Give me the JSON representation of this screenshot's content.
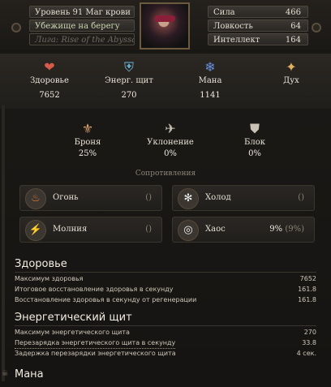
{
  "header": {
    "level_class": "Уровень 91 Маг крови",
    "area": "Убежище на берегу",
    "league": "Лига: Rise of the Abyssal",
    "attributes": [
      {
        "label": "Сила",
        "value": "466"
      },
      {
        "label": "Ловкость",
        "value": "64"
      },
      {
        "label": "Интеллект",
        "value": "164"
      }
    ]
  },
  "main_stats": [
    {
      "label": "Здоровье",
      "value": "7652",
      "icon": "heart-icon",
      "glyph": "❤",
      "color": "#d85a4a"
    },
    {
      "label": "Энерг. щит",
      "value": "270",
      "icon": "energy-shield-icon",
      "glyph": "⛨",
      "color": "#6fb6d8"
    },
    {
      "label": "Мана",
      "value": "1141",
      "icon": "mana-icon",
      "glyph": "❄",
      "color": "#6a8fe0"
    },
    {
      "label": "Дух",
      "value": "",
      "icon": "spirit-icon",
      "glyph": "✦",
      "color": "#e0b060"
    }
  ],
  "defences": [
    {
      "label": "Броня",
      "value": "25%",
      "icon": "armour-icon",
      "glyph": "⚜",
      "color": "#d8a070"
    },
    {
      "label": "Уклонение",
      "value": "0%",
      "icon": "evasion-icon",
      "glyph": "✈",
      "color": "#c9c2b4"
    },
    {
      "label": "Блок",
      "value": "0%",
      "icon": "block-icon",
      "glyph": "⛊",
      "color": "#c9c2b4"
    }
  ],
  "resistances_title": "Сопротивления",
  "resistances": [
    {
      "label": "Огонь",
      "value": "",
      "max": "()",
      "icon": "fire-icon",
      "glyph": "🔥"
    },
    {
      "label": "Холод",
      "value": "",
      "max": "()",
      "icon": "cold-icon",
      "glyph": "✻"
    },
    {
      "label": "Молния",
      "value": "",
      "max": "()",
      "icon": "lightning-icon",
      "glyph": "⚡"
    },
    {
      "label": "Хаос",
      "value": "9%",
      "max": "(9%)",
      "icon": "chaos-icon",
      "glyph": "◎"
    }
  ],
  "sections": [
    {
      "title": "Здоровье",
      "rows": [
        {
          "label": "Максимум здоровья",
          "value": "7652"
        },
        {
          "label": "Итоговое восстановление здоровья в секунду",
          "value": "161.8"
        },
        {
          "label": "Восстановление здоровья в секунду от регенерации",
          "value": "161.8"
        }
      ]
    },
    {
      "title": "Энергетический щит",
      "rows": [
        {
          "label": "Максимум энергетического щита",
          "value": "270"
        },
        {
          "label": "Перезарядка энергетического щита в секунду",
          "value": "33.8"
        },
        {
          "label": "Задержка перезарядки энергетического щита",
          "value": "4 сек."
        }
      ]
    },
    {
      "title": "Мана",
      "rows": []
    }
  ]
}
